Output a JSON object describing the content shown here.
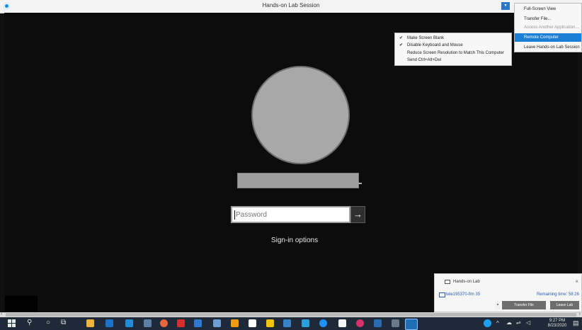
{
  "window": {
    "title": "Hands-on Lab Session"
  },
  "login": {
    "password_placeholder": "Password",
    "submit_glyph": "→",
    "sign_in_options": "Sign-in options"
  },
  "main_menu": {
    "items": [
      {
        "label": "Full-Screen View",
        "state": "normal"
      },
      {
        "label": "Transfer File...",
        "state": "normal"
      },
      {
        "label": "Access Another Application...",
        "state": "disabled"
      },
      {
        "label": "Remote Computer",
        "state": "selected"
      },
      {
        "label": "Leave Hands-on Lab Session",
        "state": "normal"
      }
    ]
  },
  "remote_submenu": {
    "items": [
      {
        "label": "Make Screen Blank",
        "checked": true
      },
      {
        "label": "Disable Keyboard and Mouse",
        "checked": true
      },
      {
        "label": "Reduce Screen Resolution to Match This Computer",
        "checked": false
      },
      {
        "label": "Send Ctrl+Alt+Del",
        "checked": false
      }
    ],
    "check_glyph": "✔"
  },
  "lab_panel": {
    "title": "Hands-on Lab",
    "close_glyph": "×",
    "host": "tele195370-flm 35",
    "remaining": "Remaining time: 58:26",
    "transfer_button": "Transfer File",
    "leave_button": "Leave Lab"
  },
  "taskbar": {
    "time": "9:27 PM",
    "date": "8/23/2020",
    "tray_caret": "^"
  },
  "colors": {
    "selected_menu": "#1c7fd6",
    "taskbar": "#1f2a38",
    "screen": "#0c0c0c"
  }
}
